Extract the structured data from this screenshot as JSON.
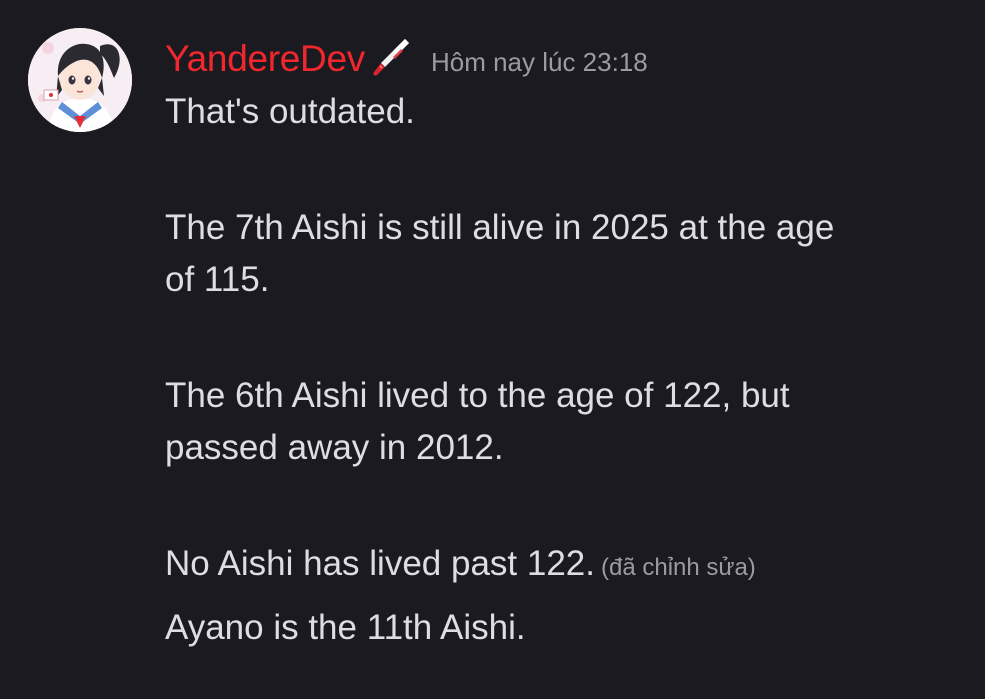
{
  "message": {
    "author": "YandereDev",
    "author_color": "#f0282d",
    "role_icon": "knife-icon",
    "timestamp": "Hôm nay lúc 23:18",
    "paragraphs": [
      [
        "That's outdated."
      ],
      [
        "The 7th Aishi is still alive in 2025 at the age",
        "of 115."
      ],
      [
        "The 6th Aishi lived to the age of 122, but",
        "passed away in 2012."
      ],
      [
        "No Aishi has lived past 122."
      ]
    ],
    "edited_label": "(đã chỉnh sửa)",
    "followup": "Ayano is the 11th Aishi."
  }
}
